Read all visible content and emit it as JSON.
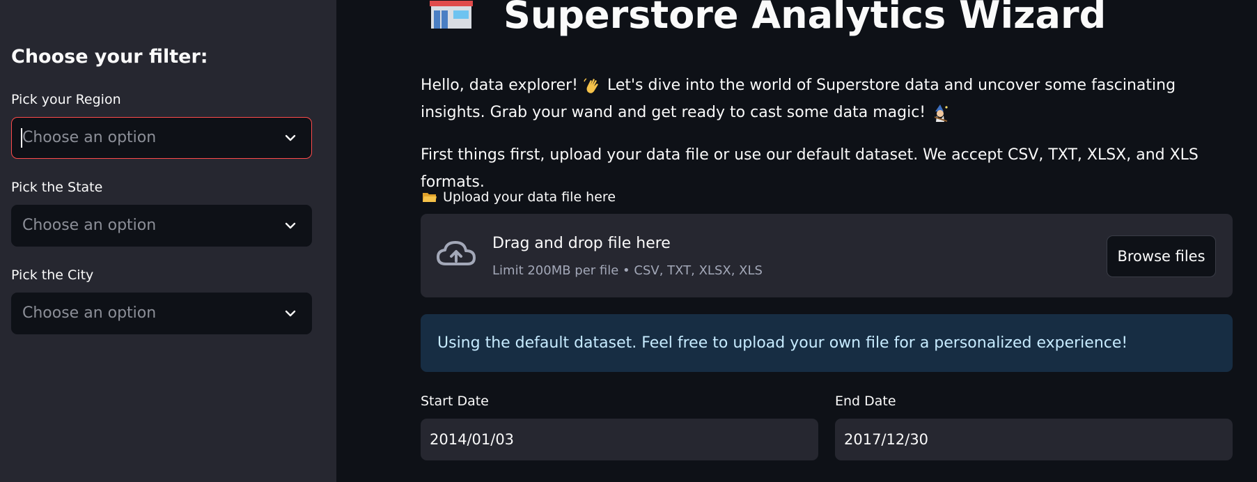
{
  "sidebar": {
    "title": "Choose your filter:",
    "filters": [
      {
        "label": "Pick your Region",
        "placeholder": "Choose an option"
      },
      {
        "label": "Pick the State",
        "placeholder": "Choose an option"
      },
      {
        "label": "Pick the City",
        "placeholder": "Choose an option"
      }
    ]
  },
  "main": {
    "title": "Superstore Analytics Wizard",
    "intro_part1": "Hello, data explorer!",
    "intro_part2": "Let's dive into the world of Superstore data and uncover some fascinating insights. Grab your wand and get ready to cast some data magic!",
    "formats_text": "First things first, upload your data file or use our default dataset. We accept CSV, TXT, XLSX, and XLS formats.",
    "upload": {
      "label": "Upload your data file here",
      "drop_title": "Drag and drop file here",
      "drop_sub": "Limit 200MB per file • CSV, TXT, XLSX, XLS",
      "browse_label": "Browse files"
    },
    "info": "Using the default dataset. Feel free to upload your own file for a personalized experience!",
    "dates": {
      "start_label": "Start Date",
      "start_value": "2014/01/03",
      "end_label": "End Date",
      "end_value": "2017/12/30"
    }
  },
  "colors": {
    "background": "#0e1117",
    "sidebar": "#262730",
    "focus_border": "#ff4b4b",
    "info_bg": "#172d43",
    "info_text": "#c7ebff"
  },
  "icons": [
    "store-icon",
    "wave-hand-icon",
    "wizard-icon",
    "folder-icon",
    "cloud-upload-icon",
    "chevron-down-icon"
  ]
}
